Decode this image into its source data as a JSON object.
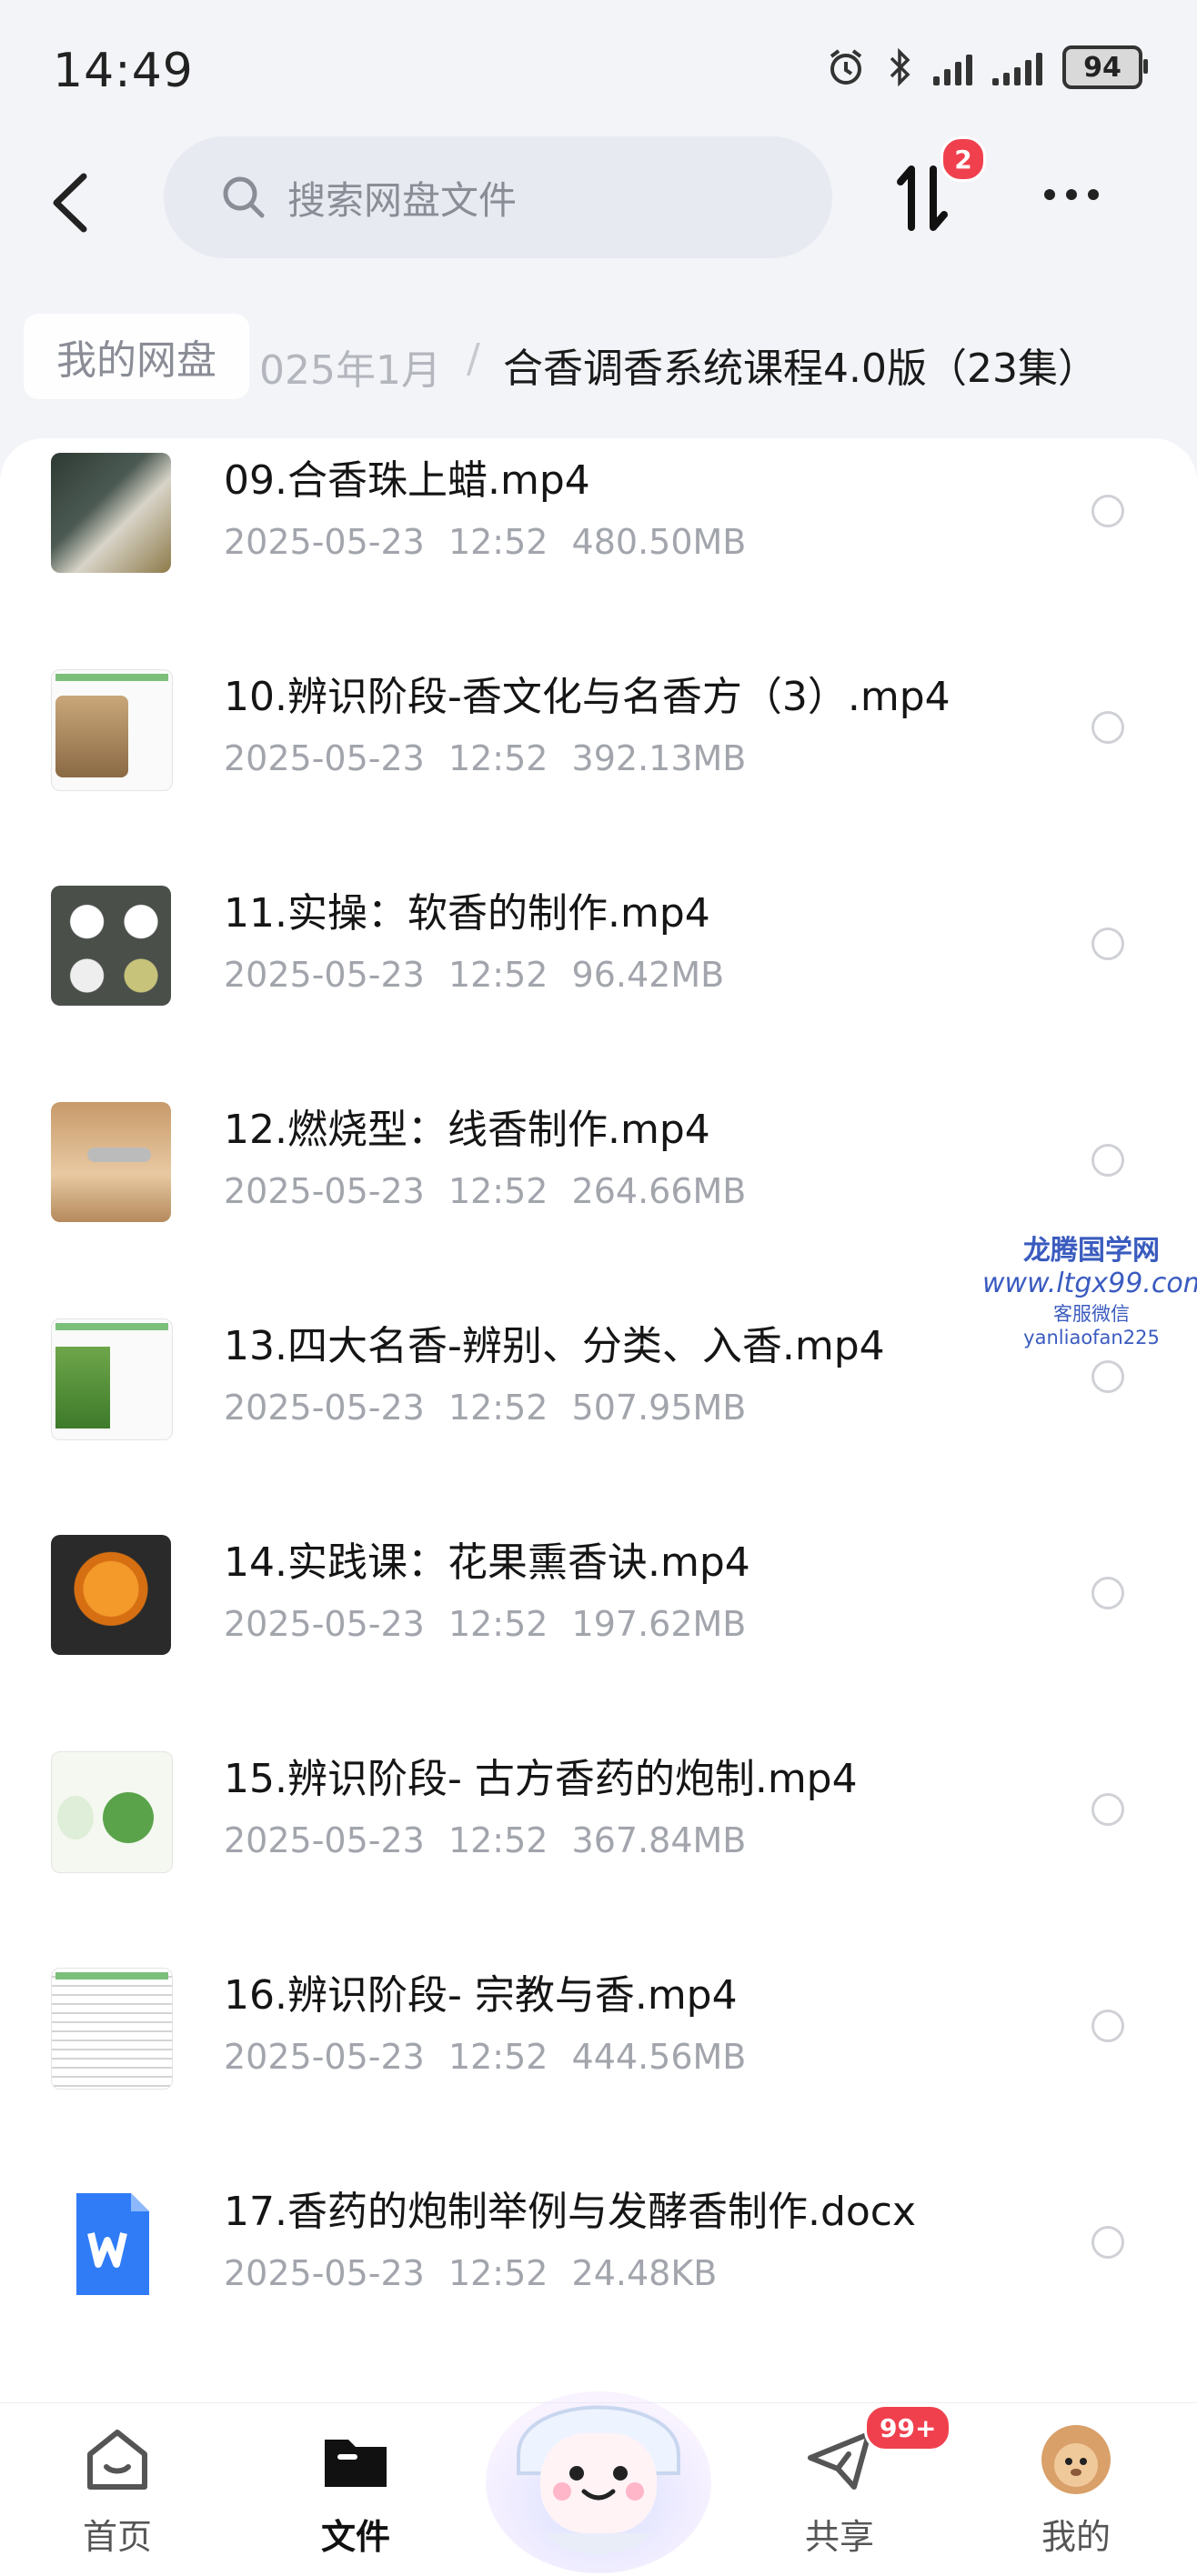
{
  "status": {
    "time": "14:49",
    "battery": "94"
  },
  "header": {
    "search_placeholder": "搜索网盘文件",
    "transfer_badge": "2"
  },
  "breadcrumb": {
    "home": "我的网盘",
    "mid": "025年1月",
    "separator": "/",
    "current": "合香调香系统课程4.0版（23集）"
  },
  "files": [
    {
      "name": "09.合香珠上蜡.mp4",
      "date": "2025-05-23",
      "time": "12:52",
      "size": "480.50MB",
      "thumb": "photo-dark"
    },
    {
      "name": "10.辨识阶段-香文化与名香方（3）.mp4",
      "date": "2025-05-23",
      "time": "12:52",
      "size": "392.13MB",
      "thumb": "doc-slide"
    },
    {
      "name": "11.实操：软香的制作.mp4",
      "date": "2025-05-23",
      "time": "12:52",
      "size": "96.42MB",
      "thumb": "photo-jars"
    },
    {
      "name": "12.燃烧型：线香制作.mp4",
      "date": "2025-05-23",
      "time": "12:52",
      "size": "264.66MB",
      "thumb": "photo-wood"
    },
    {
      "name": "13.四大名香-辨别、分类、入香.mp4",
      "date": "2025-05-23",
      "time": "12:52",
      "size": "507.95MB",
      "thumb": "doc-green"
    },
    {
      "name": "14.实践课：花果熏香诀.mp4",
      "date": "2025-05-23",
      "time": "12:52",
      "size": "197.62MB",
      "thumb": "photo-orange"
    },
    {
      "name": "15.辨识阶段- 古方香药的炮制.mp4",
      "date": "2025-05-23",
      "time": "12:52",
      "size": "367.84MB",
      "thumb": "doc-circle"
    },
    {
      "name": "16.辨识阶段- 宗教与香.mp4",
      "date": "2025-05-23",
      "time": "12:52",
      "size": "444.56MB",
      "thumb": "doc-text"
    },
    {
      "name": "17.香药的炮制举例与发酵香制作.docx",
      "date": "2025-05-23",
      "time": "12:52",
      "size": "24.48KB",
      "thumb": "word-icon"
    }
  ],
  "watermark": {
    "line1": "龙腾国学网",
    "line2": "www.ltgx99.com",
    "line3": "客服微信 yanliaofan225"
  },
  "tabs": [
    {
      "label": "首页",
      "icon": "home-icon"
    },
    {
      "label": "文件",
      "icon": "folder-icon",
      "active": true
    },
    {
      "label": "共享",
      "icon": "share-plane-icon"
    },
    {
      "label": "我的",
      "icon": "avatar-icon"
    }
  ],
  "share_badge": "99+",
  "colors": {
    "accent": "#2f7cf6",
    "badge": "#f0404e",
    "background": "#f3f4f8"
  }
}
